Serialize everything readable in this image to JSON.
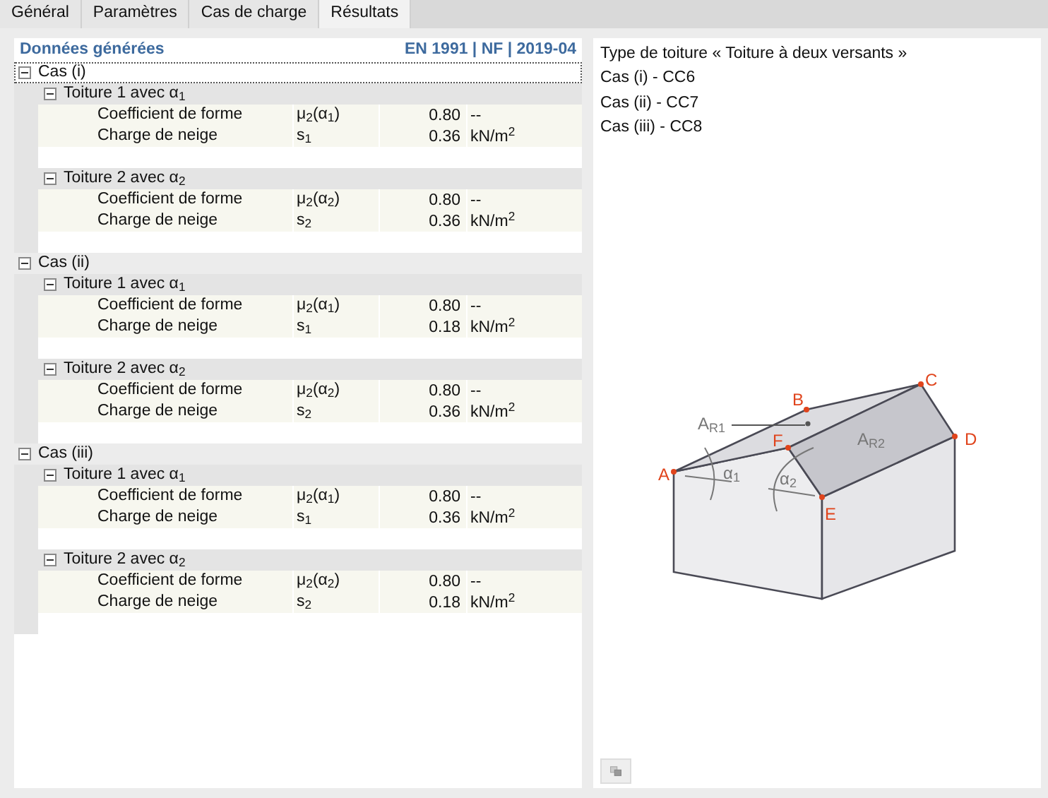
{
  "tabs": [
    {
      "label": "Général",
      "selected": false
    },
    {
      "label": "Paramètres",
      "selected": false
    },
    {
      "label": "Cas de charge",
      "selected": false
    },
    {
      "label": "Résultats",
      "selected": true
    }
  ],
  "results": {
    "title": "Données générées",
    "standard": "EN 1991 | NF | 2019-04",
    "cases": [
      {
        "label": "Cas (i)",
        "expanded": true,
        "selected": true,
        "roofs": [
          {
            "label": "Toiture 1 avec α$_{1}$",
            "expanded": true,
            "rows": [
              {
                "label": "Coefficient de forme",
                "symbol": "μ$_{2}$(α$_{1}$)",
                "value": "0.80",
                "unit": "--"
              },
              {
                "label": "Charge de neige",
                "symbol": "s$_{1}$",
                "value": "0.36",
                "unit": "kN/m$^{2}$"
              }
            ]
          },
          {
            "label": "Toiture 2 avec α$_{2}$",
            "expanded": true,
            "rows": [
              {
                "label": "Coefficient de forme",
                "symbol": "μ$_{2}$(α$_{2}$)",
                "value": "0.80",
                "unit": "--"
              },
              {
                "label": "Charge de neige",
                "symbol": "s$_{2}$",
                "value": "0.36",
                "unit": "kN/m$^{2}$"
              }
            ]
          }
        ]
      },
      {
        "label": "Cas (ii)",
        "expanded": true,
        "selected": false,
        "roofs": [
          {
            "label": "Toiture 1 avec α$_{1}$",
            "expanded": true,
            "rows": [
              {
                "label": "Coefficient de forme",
                "symbol": "μ$_{2}$(α$_{1}$)",
                "value": "0.80",
                "unit": "--"
              },
              {
                "label": "Charge de neige",
                "symbol": "s$_{1}$",
                "value": "0.18",
                "unit": "kN/m$^{2}$"
              }
            ]
          },
          {
            "label": "Toiture 2 avec α$_{2}$",
            "expanded": true,
            "rows": [
              {
                "label": "Coefficient de forme",
                "symbol": "μ$_{2}$(α$_{2}$)",
                "value": "0.80",
                "unit": "--"
              },
              {
                "label": "Charge de neige",
                "symbol": "s$_{2}$",
                "value": "0.36",
                "unit": "kN/m$^{2}$"
              }
            ]
          }
        ]
      },
      {
        "label": "Cas (iii)",
        "expanded": true,
        "selected": false,
        "roofs": [
          {
            "label": "Toiture 1 avec α$_{1}$",
            "expanded": true,
            "rows": [
              {
                "label": "Coefficient de forme",
                "symbol": "μ$_{2}$(α$_{1}$)",
                "value": "0.80",
                "unit": "--"
              },
              {
                "label": "Charge de neige",
                "symbol": "s$_{1}$",
                "value": "0.36",
                "unit": "kN/m$^{2}$"
              }
            ]
          },
          {
            "label": "Toiture 2 avec α$_{2}$",
            "expanded": true,
            "rows": [
              {
                "label": "Coefficient de forme",
                "symbol": "μ$_{2}$(α$_{2}$)",
                "value": "0.80",
                "unit": "--"
              },
              {
                "label": "Charge de neige",
                "symbol": "s$_{2}$",
                "value": "0.18",
                "unit": "kN/m$^{2}$"
              }
            ]
          }
        ]
      }
    ]
  },
  "info": {
    "lines": [
      "Type de toiture « Toiture à deux versants »",
      "Cas (i) - CC6",
      "Cas (ii) - CC7",
      "Cas (iii) - CC8"
    ]
  },
  "diagram": {
    "points": [
      "A",
      "B",
      "C",
      "D",
      "E",
      "F"
    ],
    "areas": [
      "A$_{R1}$",
      "A$_{R2}$"
    ],
    "angles": [
      "α$_{1}$",
      "α$_{2}$"
    ]
  }
}
